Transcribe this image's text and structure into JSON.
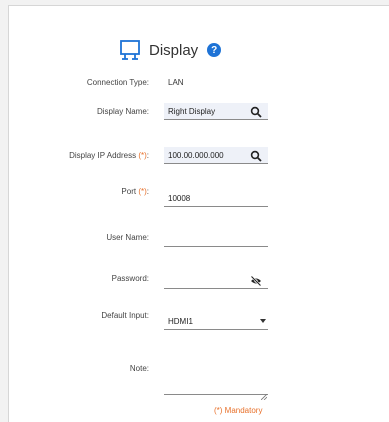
{
  "header": {
    "title": "Display",
    "help_glyph": "?"
  },
  "form": {
    "connection_type": {
      "label": "Connection Type:",
      "value": "LAN"
    },
    "display_name": {
      "label": "Display Name:",
      "value": "Right Display"
    },
    "display_ip": {
      "label": "Display IP Address",
      "required_marker": "(*)",
      "colon": ":",
      "value": "100.00.000.000"
    },
    "port": {
      "label": "Port",
      "required_marker": "(*)",
      "colon": ":",
      "value": "10008"
    },
    "user_name": {
      "label": "User Name:",
      "value": ""
    },
    "password": {
      "label": "Password:",
      "value": ""
    },
    "default_input": {
      "label": "Default Input:",
      "value": "HDMI1"
    },
    "note": {
      "label": "Note:",
      "value": ""
    }
  },
  "footer": {
    "mandatory": "(*) Mandatory"
  },
  "colors": {
    "accent": "#1e73d6",
    "required": "#e8702a",
    "field_fill": "#eef1f8"
  }
}
